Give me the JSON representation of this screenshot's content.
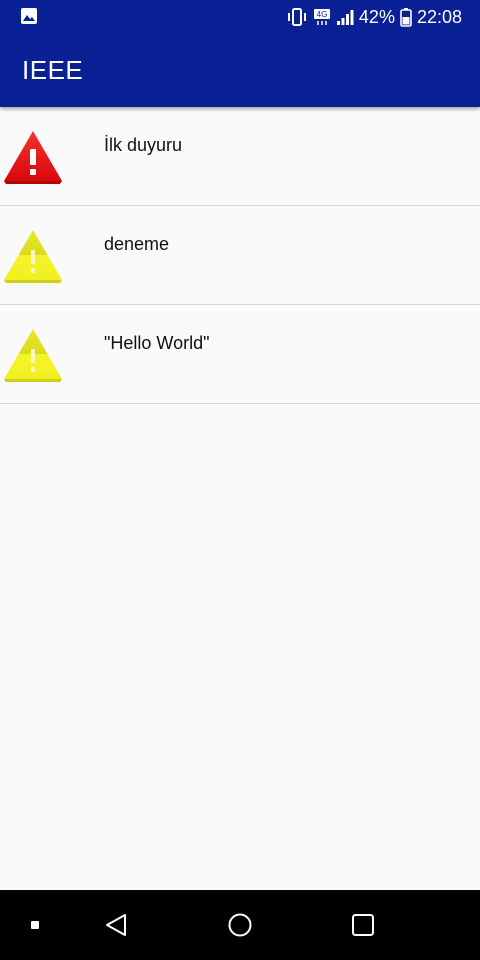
{
  "status_bar": {
    "network_label": "4G",
    "battery_percent": "42%",
    "time": "22:08",
    "icons": [
      "gallery-notification-icon",
      "vibrate-icon",
      "network-4g-icon",
      "signal-icon",
      "battery-icon"
    ]
  },
  "app_bar": {
    "title": "IEEE"
  },
  "list": {
    "items": [
      {
        "title": "İlk duyuru",
        "icon": "warning-red-icon",
        "icon_color": "#e8161b"
      },
      {
        "title": "deneme",
        "icon": "warning-yellow-icon",
        "icon_color": "#f2f21c"
      },
      {
        "title": "\"Hello World\"",
        "icon": "warning-yellow-icon",
        "icon_color": "#f2f21c"
      }
    ]
  },
  "nav_bar": {
    "icons": [
      "nav-dot-icon",
      "back-icon",
      "home-icon",
      "recents-icon"
    ]
  },
  "colors": {
    "primary": "#0a2195",
    "background": "#fafafa",
    "divider": "#d6d6d6"
  }
}
